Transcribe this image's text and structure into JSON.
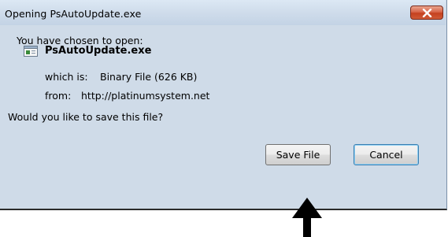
{
  "window": {
    "title": "Opening PsAutoUpdate.exe"
  },
  "dialog": {
    "intro": "You have chosen to open:",
    "filename": "PsAutoUpdate.exe",
    "which_is_label": "which is:",
    "which_is_value": "Binary File (626 KB)",
    "from_label": "from:",
    "from_value": "http://platinumsystem.net",
    "question": "Would you like to save this file?"
  },
  "buttons": {
    "save": "Save File",
    "cancel": "Cancel"
  },
  "colors": {
    "close_button": "#c5411f",
    "arrow": "#000000"
  }
}
